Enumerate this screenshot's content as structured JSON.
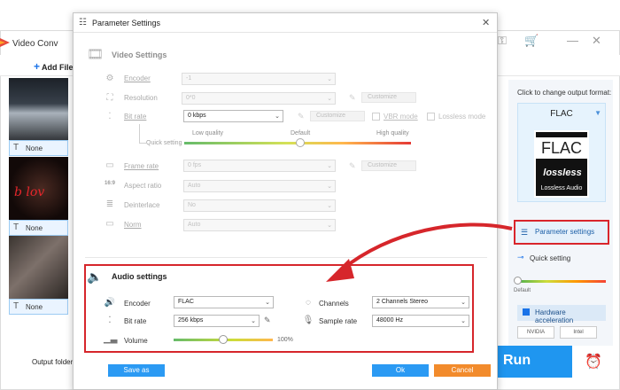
{
  "app": {
    "title": "Video Conv",
    "add_file": "Add File",
    "output_folder": "Output folder:",
    "thumbs": [
      {
        "subtitle": "None"
      },
      {
        "subtitle": "None"
      },
      {
        "subtitle": "None"
      }
    ],
    "right_panel": {
      "hint": "Click to change output format:",
      "format_name": "FLAC",
      "icon_big": "FLAC",
      "icon_lossless": "lossless",
      "icon_sub": "Lossless Audio",
      "param_settings": "Parameter settings",
      "quick_setting": "Quick setting",
      "quick_default": "Default",
      "hw_acceleration": "Hardware acceleration",
      "vendor_nvidia": "NVIDIA",
      "vendor_intel": "Intel"
    },
    "run": "Run"
  },
  "dialog": {
    "title": "Parameter Settings",
    "video": {
      "heading": "Video Settings",
      "encoder": {
        "label": "Encoder",
        "value": "-1"
      },
      "resolution": {
        "label": "Resolution",
        "value": "0*0",
        "customize": "Customize"
      },
      "bitrate": {
        "label": "Bit rate",
        "value": "0 kbps",
        "customize": "Customize",
        "vbr": "VBR mode",
        "lossless": "Lossless mode"
      },
      "quick": {
        "label": "Quick setting",
        "low": "Low quality",
        "default": "Default",
        "high": "High quality"
      },
      "framerate": {
        "label": "Frame rate",
        "value": "0 fps",
        "customize": "Customize"
      },
      "aspect": {
        "label": "Aspect ratio",
        "value": "Auto"
      },
      "deinterlace": {
        "label": "Deinterlace",
        "value": "No"
      },
      "norm": {
        "label": "Norm",
        "value": "Auto"
      }
    },
    "audio": {
      "heading": "Audio settings",
      "encoder": {
        "label": "Encoder",
        "value": "FLAC"
      },
      "bitrate": {
        "label": "Bit rate",
        "value": "256 kbps"
      },
      "volume": {
        "label": "Volume",
        "value": "100%",
        "level": 0.5
      },
      "channels": {
        "label": "Channels",
        "value": "2 Channels Stereo"
      },
      "samplerate": {
        "label": "Sample rate",
        "value": "48000 Hz"
      }
    },
    "buttons": {
      "save_as": "Save as",
      "ok": "Ok",
      "cancel": "Cancel"
    }
  },
  "colors": {
    "accent_blue": "#2b9af3",
    "cancel_orange": "#f28b2c",
    "highlight_red": "#d6262b"
  }
}
